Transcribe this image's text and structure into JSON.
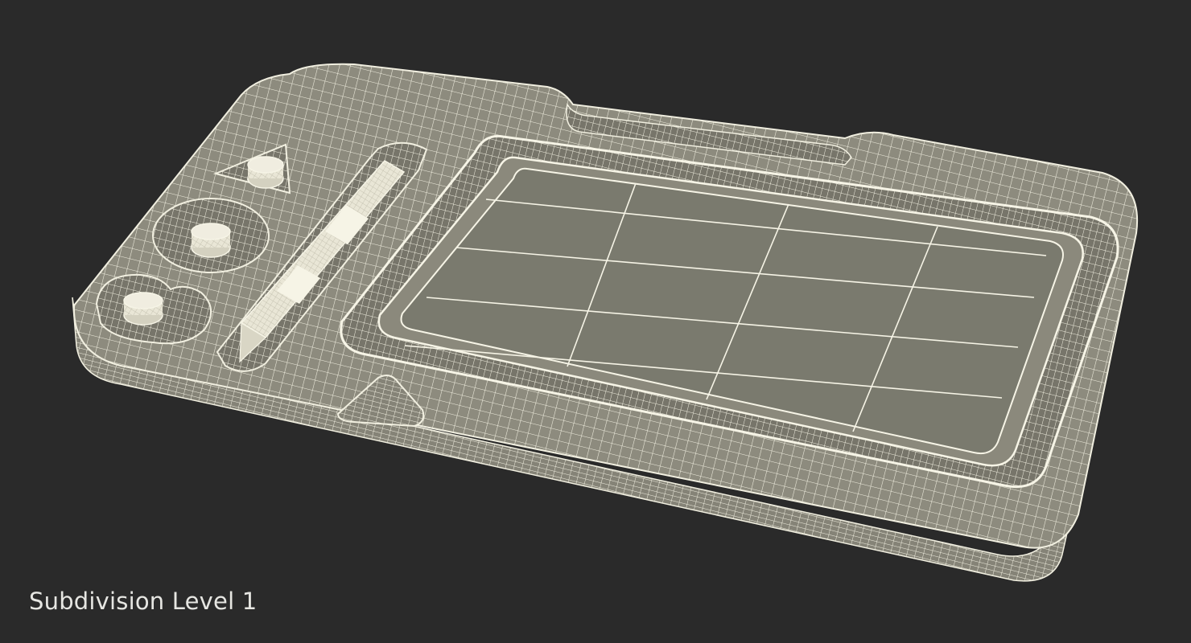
{
  "caption": {
    "text": "Subdivision Level 1"
  },
  "colors": {
    "background": "#2a2a2a",
    "wire": "#f1efe0",
    "body_fill": "#8c8a7d",
    "body_dark": "#6f6d62",
    "screen_fill": "#7a7a6e",
    "caption_text": "#e6e6e2"
  }
}
